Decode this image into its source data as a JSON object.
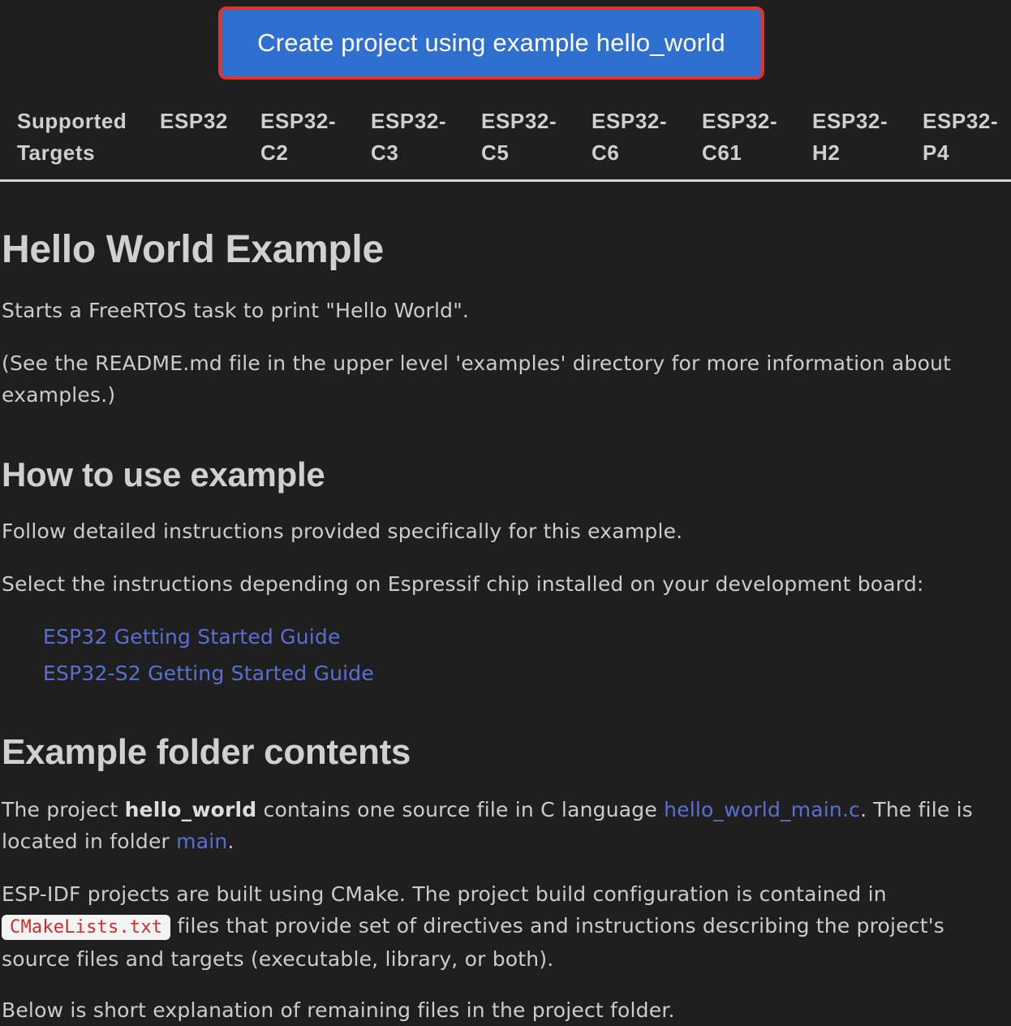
{
  "create_button": {
    "label": "Create project using example hello_world"
  },
  "targets_table": {
    "headers": [
      "Supported\nTargets",
      "ESP32",
      "ESP32-\nC2",
      "ESP32-\nC3",
      "ESP32-\nC5",
      "ESP32-\nC6",
      "ESP32-\nC61",
      "ESP32-\nH2",
      "ESP32-\nP4"
    ]
  },
  "readme": {
    "title": "Hello World Example",
    "intro": "Starts a FreeRTOS task to print \"Hello World\".",
    "see_readme": "(See the README.md file in the upper level 'examples' directory for more information about examples.)",
    "how_to_heading": "How to use example",
    "follow_text": "Follow detailed instructions provided specifically for this example.",
    "select_text": "Select the instructions depending on Espressif chip installed on your development board:",
    "guides": [
      "ESP32 Getting Started Guide",
      "ESP32-S2 Getting Started Guide"
    ],
    "folder_heading": "Example folder contents",
    "project_p1": "The project ",
    "project_name": "hello_world",
    "project_p2": " contains one source file in C language ",
    "source_file_link": "hello_world_main.c",
    "project_p3": ". The file is located in folder ",
    "folder_link": "main",
    "project_p4": ".",
    "cmake_p1": "ESP-IDF projects are built using CMake. The project build configuration is contained in ",
    "cmake_code": "CMakeLists.txt",
    "cmake_p2": " files that provide set of directives and instructions describing the project's source files and targets (executable, library, or both).",
    "below_text": "Below is short explanation of remaining files in the project folder."
  }
}
